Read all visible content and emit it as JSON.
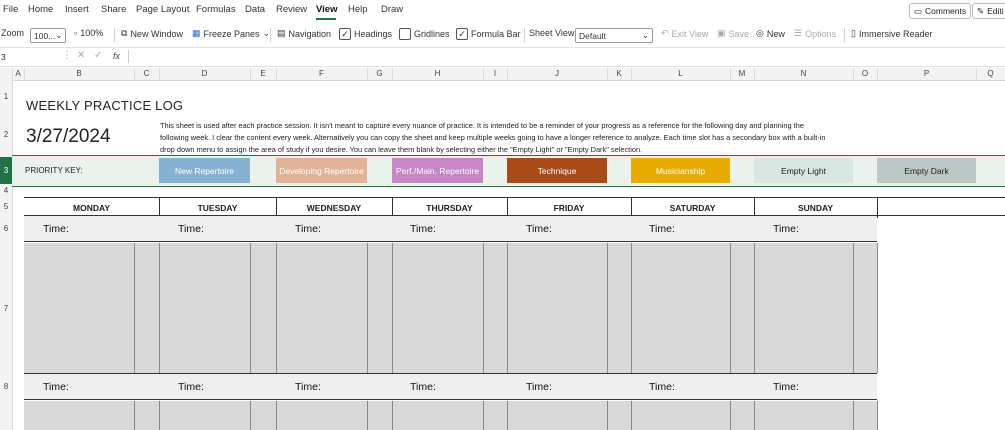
{
  "menu": [
    "File",
    "Home",
    "Insert",
    "Share",
    "Page Layout",
    "Formulas",
    "Data",
    "Review",
    "View",
    "Help",
    "Draw"
  ],
  "top_buttons": {
    "comments": "Comments",
    "editing": "Editi"
  },
  "ribbon": {
    "zoom_label": "Zoom",
    "zoom_value": "100...",
    "zoom100": "100%",
    "new_window": "New Window",
    "freeze_panes": "Freeze Panes",
    "navigation": "Navigation",
    "headings": "Headings",
    "gridlines": "Gridlines",
    "formula_bar": "Formula Bar",
    "sheet_view_label": "Sheet View",
    "sheet_view_value": "Default",
    "exit_view": "Exit View",
    "save": "Save",
    "new": "New",
    "options": "Options",
    "immersive_reader": "Immersive Reader"
  },
  "formula": {
    "name_box": "3",
    "fx": "fx"
  },
  "columns": [
    "A",
    "B",
    "C",
    "D",
    "E",
    "F",
    "G",
    "H",
    "I",
    "J",
    "K",
    "L",
    "M",
    "N",
    "O",
    "P",
    "Q"
  ],
  "rows": [
    "1",
    "2",
    "3",
    "4",
    "5",
    "6",
    "7",
    "8"
  ],
  "sheet": {
    "title": "WEEKLY PRACTICE LOG",
    "date": "3/27/2024",
    "description_lines": [
      "This sheet is used after each practice session. It isn't meant to capture every nuance of practice. It is intended to be a reminder of your progress as a reference for the following day and planning the",
      "following week. I clear the content every week. Alternatively you can copy the sheet and keep multiple weeks going to have a longer reference to analyze. Each time slot has a secondary box with a built-in",
      "drop down menu to assign the area of study if you desire. You can leave them blank by selecting either the \"Empty Light\" or \"Empty Dark\" selection."
    ],
    "priority_key_label": "PRIORITY KEY:",
    "priority_keys": [
      {
        "label": "New Repertoire",
        "color": "#87b1d2",
        "text_color": "#ffffff"
      },
      {
        "label": "Developing Repertoire",
        "color": "#e1b295",
        "text_color": "#ffffff"
      },
      {
        "label": "Perf./Main. Repertoire",
        "color": "#c787c7",
        "text_color": "#ffffff"
      },
      {
        "label": "Technique",
        "color": "#a94b18",
        "text_color": "#ffffff"
      },
      {
        "label": "Musicianship",
        "color": "#e8ab00",
        "text_color": "#ffffff"
      },
      {
        "label": "Empty Light",
        "color": "#d9e7e2",
        "text_color": "#222222"
      },
      {
        "label": "Empty Dark",
        "color": "#bcc8c5",
        "text_color": "#222222"
      }
    ],
    "days": [
      "MONDAY",
      "TUESDAY",
      "WEDNESDAY",
      "THURSDAY",
      "FRIDAY",
      "SATURDAY",
      "SUNDAY"
    ],
    "time_label": "Time:"
  }
}
